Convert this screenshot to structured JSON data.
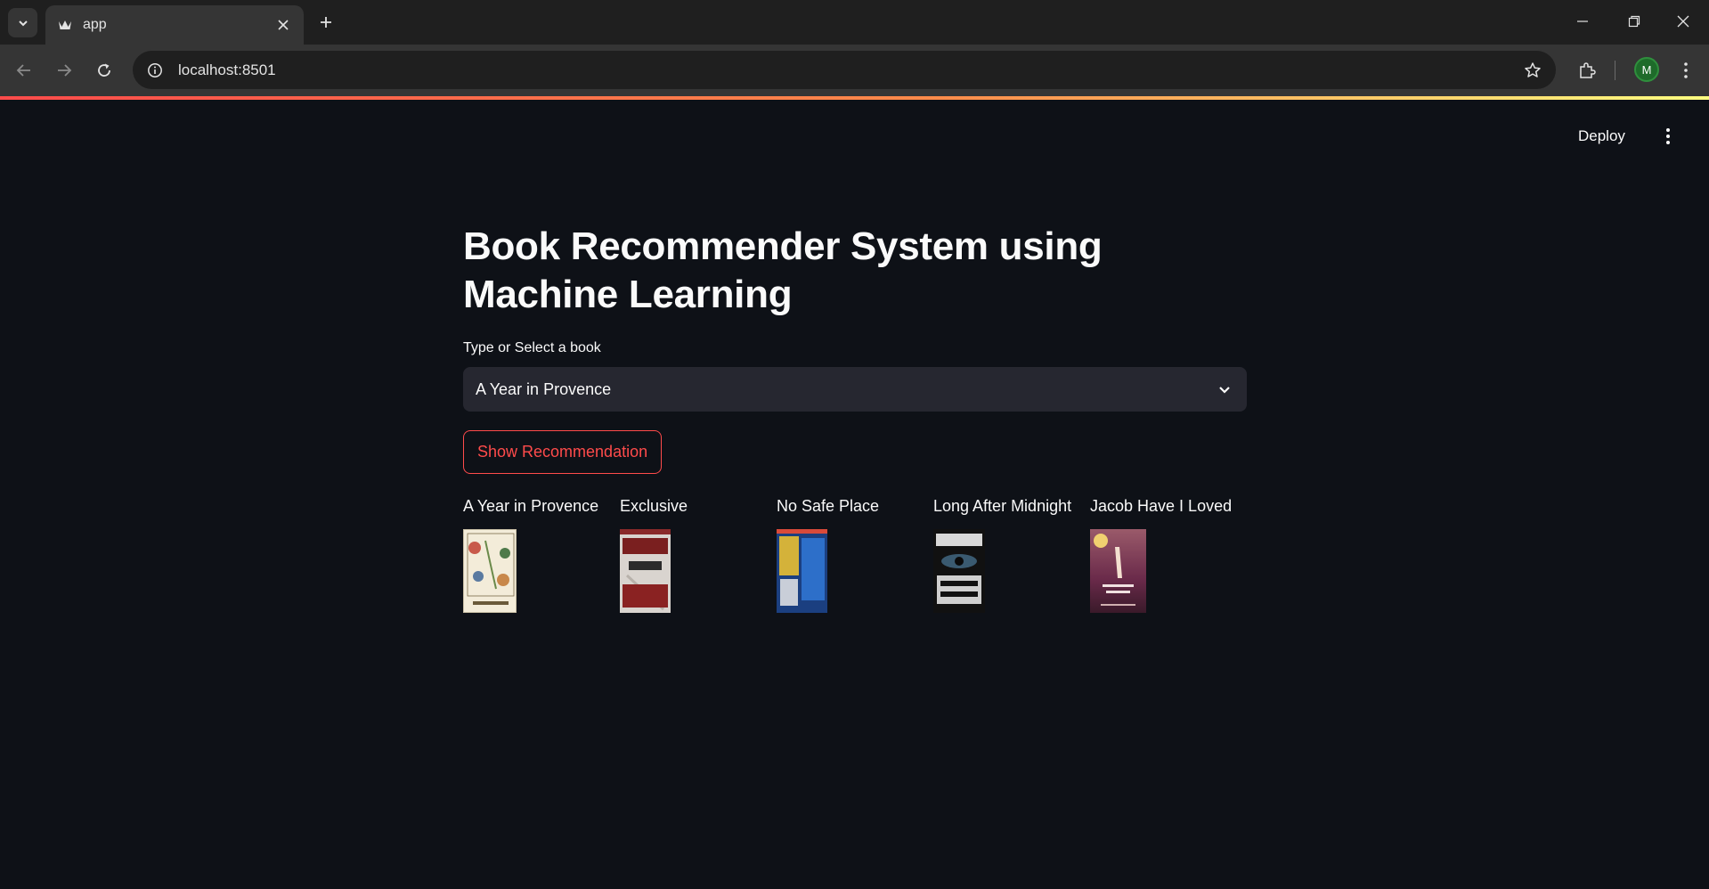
{
  "browser": {
    "tab_title": "app",
    "url": "localhost:8501",
    "profile_initial": "M"
  },
  "header": {
    "deploy_label": "Deploy"
  },
  "main": {
    "title": "Book Recommender System using Machine Learning",
    "select_label": "Type or Select a book",
    "select_value": "A Year in Provence",
    "button_label": "Show Recommendation"
  },
  "recommendations": [
    {
      "title": "A Year in Provence",
      "cover_lines": [
        "A Year in Provence",
        "PETER MAYLE"
      ]
    },
    {
      "title": "Exclusive",
      "cover_lines": [
        "SANDRA",
        "EXCLUSIVE",
        "BROWN"
      ]
    },
    {
      "title": "No Safe Place",
      "cover_lines": [
        "richard north patterson",
        "NO SAFE PLACE"
      ]
    },
    {
      "title": "Long After Midnight",
      "cover_lines": [
        "JOHANSEN",
        "LONG AFTER MIDNIGHT"
      ]
    },
    {
      "title": "Jacob Have I Loved",
      "cover_lines": [
        "JACOB HAVE I LOVED",
        "KATHERINE PATERSON"
      ]
    }
  ],
  "colors": {
    "accent": "#ff4b4b",
    "background": "#0e1117",
    "input_bg": "#262730"
  }
}
